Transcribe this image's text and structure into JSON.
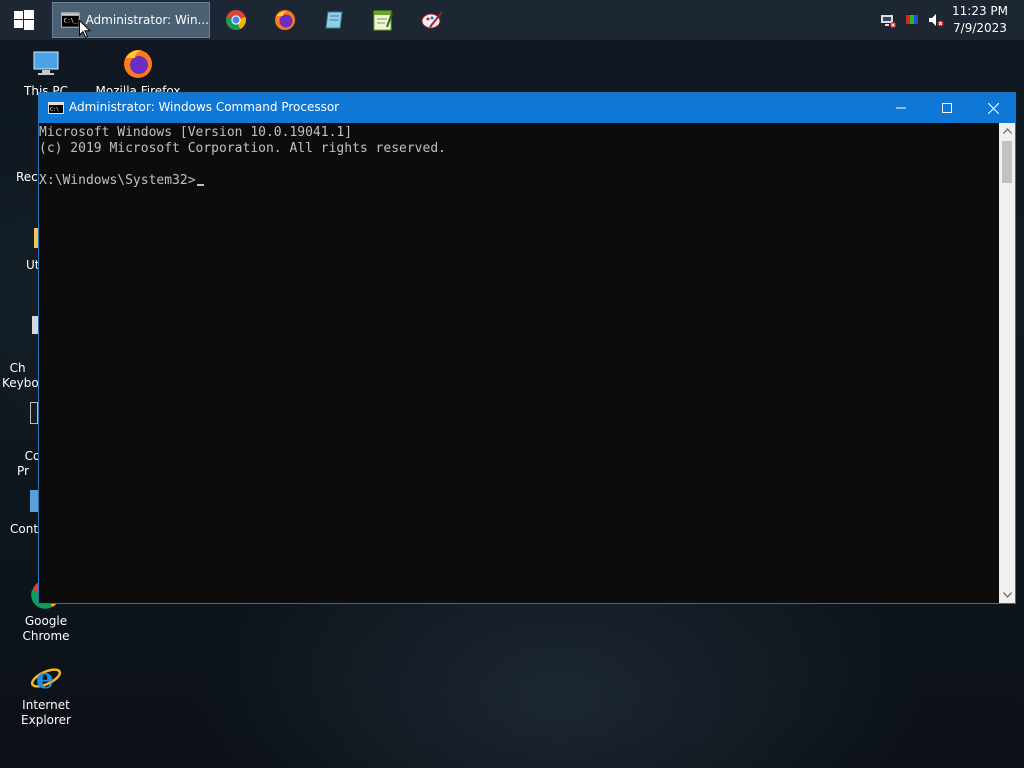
{
  "taskbar": {
    "start_icon": "windows-logo-icon",
    "active_task": {
      "label": "Administrator: Win...",
      "icon": "cmd-icon"
    },
    "pinned": [
      {
        "name": "chrome-icon"
      },
      {
        "name": "firefox-icon"
      },
      {
        "name": "notepad-icon"
      },
      {
        "name": "editor-icon"
      },
      {
        "name": "paint-icon"
      }
    ],
    "tray_icons": [
      "network-icon",
      "color-icon",
      "volume-muted-icon"
    ],
    "clock": {
      "time": "11:23 PM",
      "date": "7/9/2023"
    }
  },
  "desktop": {
    "icons": [
      {
        "label": "This PC",
        "icon": "computer-icon"
      },
      {
        "label": "Mozilla Firefox",
        "icon": "firefox-icon"
      },
      {
        "label": "Recy",
        "icon": "recycle-bin-icon"
      },
      {
        "label": "Ut",
        "icon": "folder-icon"
      },
      {
        "label": "Ch\nKeyboa",
        "icon": "keyboard-icon"
      },
      {
        "label": "Con\nPr",
        "icon": "cmd-icon"
      },
      {
        "label": "Contr",
        "icon": "control-panel-icon"
      },
      {
        "label": "Google Chrome",
        "icon": "chrome-icon"
      },
      {
        "label": "Internet Explorer",
        "icon": "ie-icon"
      }
    ]
  },
  "window": {
    "title": "Administrator: Windows Command Processor",
    "console_lines": [
      "Microsoft Windows [Version 10.0.19041.1]",
      "(c) 2019 Microsoft Corporation. All rights reserved.",
      "",
      "X:\\Windows\\System32>"
    ]
  },
  "colors": {
    "titlebar": "#0f78d7",
    "taskbar": "#1d2733",
    "console_bg": "#0c0c0c",
    "console_text": "#c0c0c0"
  }
}
